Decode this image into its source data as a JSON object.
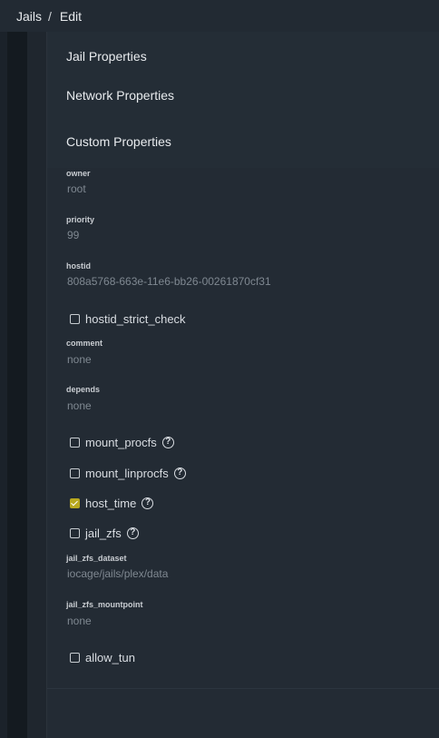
{
  "breadcrumb": {
    "parent": "Jails",
    "separator": "/",
    "current": "Edit"
  },
  "sections": {
    "jail_properties": "Jail Properties",
    "network_properties": "Network Properties",
    "custom_properties": "Custom Properties"
  },
  "fields": {
    "owner": {
      "label": "owner",
      "value": "root"
    },
    "priority": {
      "label": "priority",
      "value": "99"
    },
    "hostid": {
      "label": "hostid",
      "value": "808a5768-663e-11e6-bb26-00261870cf31"
    },
    "comment": {
      "label": "comment",
      "value": "none"
    },
    "depends": {
      "label": "depends",
      "value": "none"
    },
    "jail_zfs_dataset": {
      "label": "jail_zfs_dataset",
      "value": "iocage/jails/plex/data"
    },
    "jail_zfs_mountpoint": {
      "label": "jail_zfs_mountpoint",
      "value": "none"
    }
  },
  "checkboxes": {
    "hostid_strict_check": {
      "label": "hostid_strict_check",
      "checked": false
    },
    "mount_procfs": {
      "label": "mount_procfs",
      "checked": false,
      "help_icon": "question-circle-icon"
    },
    "mount_linprocfs": {
      "label": "mount_linprocfs",
      "checked": false,
      "help_icon": "question-circle-icon"
    },
    "host_time": {
      "label": "host_time",
      "checked": true,
      "help_icon": "question-circle-icon"
    },
    "jail_zfs": {
      "label": "jail_zfs",
      "checked": false,
      "help_icon": "question-circle-icon"
    },
    "allow_tun": {
      "label": "allow_tun",
      "checked": false
    }
  },
  "help_glyph": "?",
  "colors": {
    "background": "#1b222a",
    "panel": "#232b34",
    "topbar": "#222a33",
    "checked_accent": "#b8a81f",
    "muted_value": "#7f8891"
  }
}
